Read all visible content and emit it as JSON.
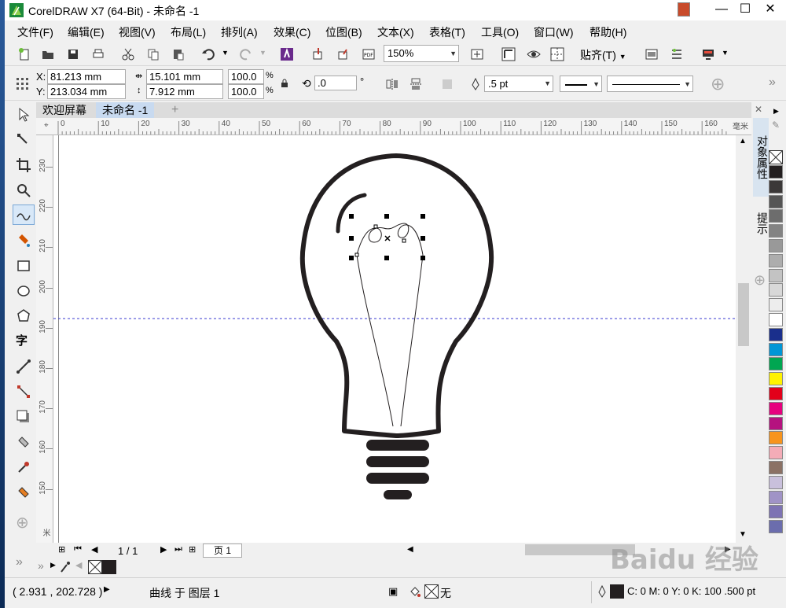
{
  "window": {
    "title": "CorelDRAW X7 (64-Bit) - 未命名 -1",
    "minimize": "—",
    "maximize": "☐",
    "close": "✕"
  },
  "menu": [
    "文件(F)",
    "编辑(E)",
    "视图(V)",
    "布局(L)",
    "排列(A)",
    "效果(C)",
    "位图(B)",
    "文本(X)",
    "表格(T)",
    "工具(O)",
    "窗口(W)",
    "帮助(H)"
  ],
  "toolbar": {
    "zoom_value": "150%",
    "snap_label": "贴齐(T)"
  },
  "property_bar": {
    "x_label": "X:",
    "y_label": "Y:",
    "x_value": "81.213 mm",
    "y_value": "213.034 mm",
    "width_value": "15.101 mm",
    "height_value": "7.912 mm",
    "scale_x": "100.0",
    "scale_y": "100.0",
    "percent": "%",
    "rotation": ".0",
    "degree": "°",
    "outline_width": ".5 pt"
  },
  "doc_tabs": [
    "欢迎屏幕",
    "未命名 -1"
  ],
  "rulers": {
    "h_ticks": [
      "0",
      "10",
      "20",
      "30",
      "40",
      "50",
      "60",
      "70",
      "80",
      "90",
      "100",
      "110",
      "120",
      "130",
      "140",
      "150",
      "160"
    ],
    "h_unit": "毫米",
    "v_ticks": [
      "230",
      "220",
      "210",
      "200",
      "190",
      "180",
      "170",
      "160",
      "150"
    ],
    "v_unit": "毫米"
  },
  "page_nav": {
    "counter": "1 / 1",
    "page_tab": "页 1"
  },
  "dockers": [
    "对象属性",
    "提示"
  ],
  "palette_colors": [
    "#231f20",
    "#3b3838",
    "#555555",
    "#6d6d6d",
    "#838383",
    "#999999",
    "#adadad",
    "#c3c3c3",
    "#d8d8d8",
    "#ededed",
    "#ffffff",
    "#1a2f8c",
    "#0096d6",
    "#00a651",
    "#fff200",
    "#e2001a",
    "#e6007e",
    "#b5127f",
    "#f7941d",
    "#f4acb7",
    "#8b7165",
    "#c9c0dc",
    "#a093c6",
    "#7d73b3",
    "#6b6dad"
  ],
  "status": {
    "coords": "( 2.931 , 202.728 )",
    "object_info": "曲线 于 图层 1",
    "fill_none": "无",
    "outline_info": "C: 0 M: 0 Y: 0 K: 100  .500 pt"
  },
  "watermark": "Baidu 经验"
}
